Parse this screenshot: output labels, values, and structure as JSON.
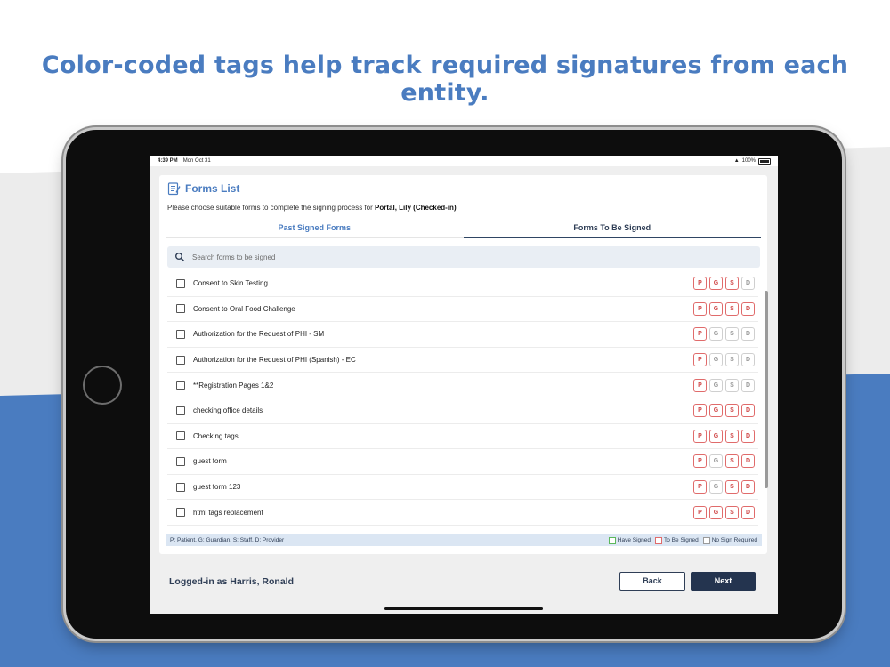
{
  "headline": "Color-coded tags help track required signatures from each entity.",
  "status_bar": {
    "time": "4:39 PM",
    "date": "Mon Oct 31",
    "battery": "100%"
  },
  "page": {
    "title": "Forms List",
    "subtitle_prefix": "Please choose suitable forms to complete the signing process for",
    "patient": "Portal, Lily (Checked-in)"
  },
  "tabs": [
    {
      "label": "Past Signed Forms",
      "active": false
    },
    {
      "label": "Forms To Be Signed",
      "active": true
    }
  ],
  "search": {
    "placeholder": "Search forms to be signed"
  },
  "forms": [
    {
      "name": "Consent to Skin Testing",
      "tags": [
        {
          "t": "P",
          "s": "red"
        },
        {
          "t": "G",
          "s": "red"
        },
        {
          "t": "S",
          "s": "red"
        },
        {
          "t": "D",
          "s": "grey"
        }
      ]
    },
    {
      "name": "Consent to Oral Food Challenge",
      "tags": [
        {
          "t": "P",
          "s": "red"
        },
        {
          "t": "G",
          "s": "red"
        },
        {
          "t": "S",
          "s": "red"
        },
        {
          "t": "D",
          "s": "red"
        }
      ]
    },
    {
      "name": "Authorization for the Request of PHI - SM",
      "tags": [
        {
          "t": "P",
          "s": "red"
        },
        {
          "t": "G",
          "s": "grey"
        },
        {
          "t": "S",
          "s": "grey"
        },
        {
          "t": "D",
          "s": "grey"
        }
      ]
    },
    {
      "name": "Authorization for the Request of PHI (Spanish) - EC",
      "tags": [
        {
          "t": "P",
          "s": "red"
        },
        {
          "t": "G",
          "s": "grey"
        },
        {
          "t": "S",
          "s": "grey"
        },
        {
          "t": "D",
          "s": "grey"
        }
      ]
    },
    {
      "name": "**Registration Pages 1&2",
      "tags": [
        {
          "t": "P",
          "s": "red"
        },
        {
          "t": "G",
          "s": "grey"
        },
        {
          "t": "S",
          "s": "grey"
        },
        {
          "t": "D",
          "s": "grey"
        }
      ]
    },
    {
      "name": "checking office details",
      "tags": [
        {
          "t": "P",
          "s": "red"
        },
        {
          "t": "G",
          "s": "red"
        },
        {
          "t": "S",
          "s": "red"
        },
        {
          "t": "D",
          "s": "red"
        }
      ]
    },
    {
      "name": "Checking tags",
      "tags": [
        {
          "t": "P",
          "s": "red"
        },
        {
          "t": "G",
          "s": "red"
        },
        {
          "t": "S",
          "s": "red"
        },
        {
          "t": "D",
          "s": "red"
        }
      ]
    },
    {
      "name": "guest form",
      "tags": [
        {
          "t": "P",
          "s": "red"
        },
        {
          "t": "G",
          "s": "grey"
        },
        {
          "t": "S",
          "s": "red"
        },
        {
          "t": "D",
          "s": "red"
        }
      ]
    },
    {
      "name": "guest form 123",
      "tags": [
        {
          "t": "P",
          "s": "red"
        },
        {
          "t": "G",
          "s": "grey"
        },
        {
          "t": "S",
          "s": "red"
        },
        {
          "t": "D",
          "s": "red"
        }
      ]
    },
    {
      "name": "html tags replacement",
      "tags": [
        {
          "t": "P",
          "s": "red"
        },
        {
          "t": "G",
          "s": "red"
        },
        {
          "t": "S",
          "s": "red"
        },
        {
          "t": "D",
          "s": "red"
        }
      ]
    }
  ],
  "legend": {
    "key": "P: Patient, G: Guardian, S: Staff, D: Provider",
    "have_signed": "Have Signed",
    "to_be_signed": "To Be Signed",
    "no_sign": "No Sign Required"
  },
  "footer": {
    "logged_in": "Logged-in as Harris, Ronald",
    "back_label": "Back",
    "next_label": "Next"
  },
  "colors": {
    "accent": "#4a7cc0",
    "navy": "#24344f",
    "to_be_signed": "#e06b6b",
    "have_signed": "#5cb85c",
    "no_sign": "#9a9a9a"
  }
}
